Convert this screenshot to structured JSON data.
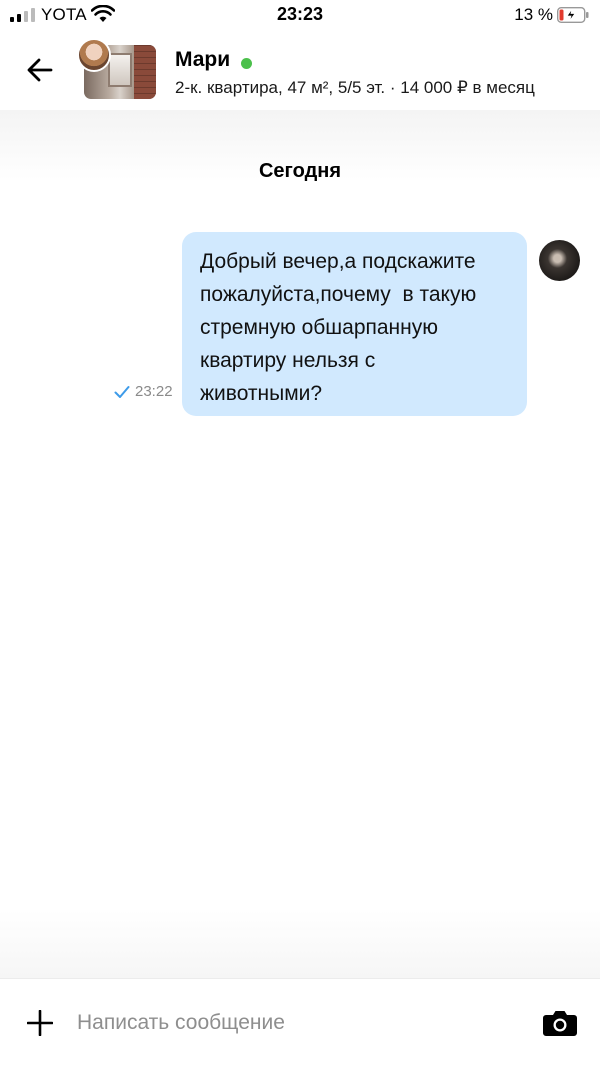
{
  "status_bar": {
    "carrier": "YOTA",
    "time": "23:23",
    "battery_percent": "13 %",
    "icons": [
      "signal-icon",
      "wifi-icon",
      "battery-charging-icon"
    ]
  },
  "header": {
    "contact_name": "Мари",
    "online": true,
    "listing_info": "2-к. квартира, 47 м², 5/5 эт. · 14 000 ₽ в месяц",
    "icons": [
      "back-arrow-icon"
    ]
  },
  "chat": {
    "date_separator": "Сегодня",
    "messages": [
      {
        "lines": [
          "Добрый вечер,а подскажите",
          "пожалуйста,почему  в такую",
          "стремную обшарпанную",
          "квартиру нельзя с",
          "животными?"
        ],
        "time": "23:22",
        "status": "sent"
      }
    ]
  },
  "composer": {
    "placeholder": "Написать сообщение",
    "value": "",
    "icons": [
      "plus-icon",
      "camera-icon"
    ]
  },
  "colors": {
    "bubble": "#d1e9fe",
    "online": "#4bc04b",
    "check": "#3d9be9",
    "battery_low": "#e23b2e"
  }
}
